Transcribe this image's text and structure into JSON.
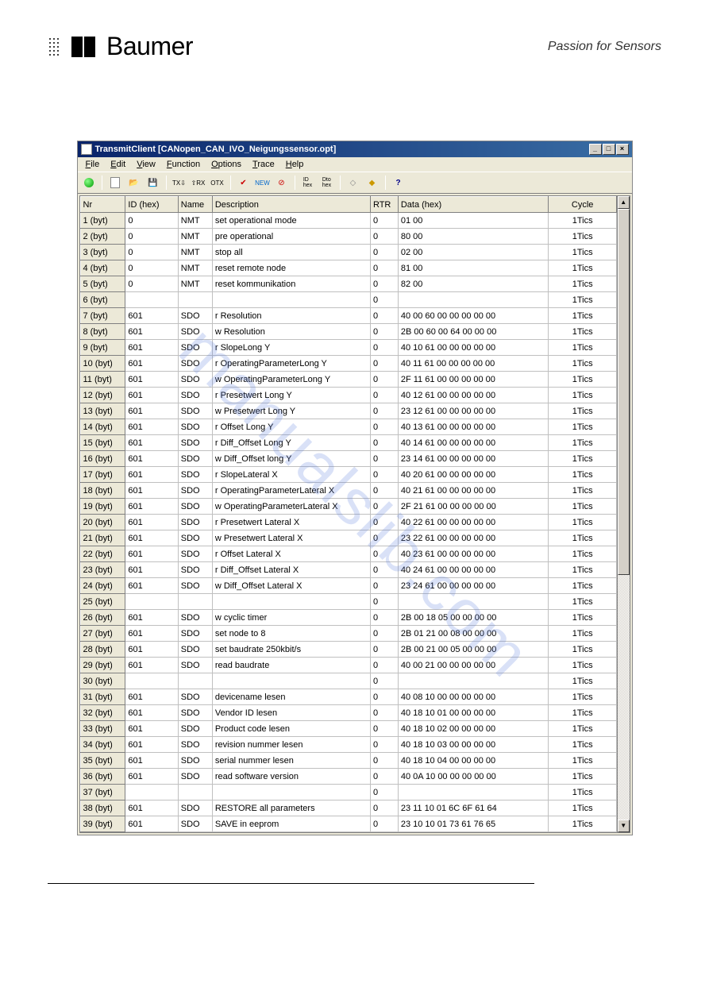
{
  "brand": {
    "name": "Baumer",
    "tagline": "Passion for Sensors"
  },
  "watermark": "manualslib.com",
  "window": {
    "title": "TransmitClient [CANopen_CAN_IVO_Neigungssensor.opt]",
    "menus": [
      "File",
      "Edit",
      "View",
      "Function",
      "Options",
      "Trace",
      "Help"
    ],
    "win_btns": {
      "min": "_",
      "max": "□",
      "close": "×"
    }
  },
  "toolbar": {
    "groups": [
      [
        "green"
      ],
      [
        "new",
        "open",
        "save"
      ],
      [
        "tx",
        "rx",
        "otx"
      ],
      [
        "check",
        "new2",
        "stop"
      ],
      [
        "idhex",
        "dtohex"
      ],
      [
        "up",
        "down"
      ],
      [
        "help"
      ]
    ]
  },
  "grid": {
    "headers": [
      "Nr",
      "ID (hex)",
      "Name",
      "Description",
      "RTR",
      "Data (hex)",
      "Cycle"
    ],
    "rows": [
      {
        "nr": "1 (byt)",
        "id": "0",
        "name": "NMT",
        "desc": "set operational mode",
        "rtr": "0",
        "data": "01 00",
        "cycle": "1Tics"
      },
      {
        "nr": "2 (byt)",
        "id": "0",
        "name": "NMT",
        "desc": "pre operational",
        "rtr": "0",
        "data": "80 00",
        "cycle": "1Tics"
      },
      {
        "nr": "3 (byt)",
        "id": "0",
        "name": "NMT",
        "desc": "stop all",
        "rtr": "0",
        "data": "02 00",
        "cycle": "1Tics"
      },
      {
        "nr": "4 (byt)",
        "id": "0",
        "name": "NMT",
        "desc": "reset remote node",
        "rtr": "0",
        "data": "81 00",
        "cycle": "1Tics"
      },
      {
        "nr": "5 (byt)",
        "id": "0",
        "name": "NMT",
        "desc": "reset kommunikation",
        "rtr": "0",
        "data": "82 00",
        "cycle": "1Tics"
      },
      {
        "nr": "6 (byt)",
        "id": "",
        "name": "",
        "desc": "",
        "rtr": "0",
        "data": "",
        "cycle": "1Tics"
      },
      {
        "nr": "7 (byt)",
        "id": "601",
        "name": "SDO",
        "desc": "r Resolution",
        "rtr": "0",
        "data": "40 00 60 00 00 00 00 00",
        "cycle": "1Tics"
      },
      {
        "nr": "8 (byt)",
        "id": "601",
        "name": "SDO",
        "desc": "w Resolution",
        "rtr": "0",
        "data": "2B 00 60 00 64 00 00 00",
        "cycle": "1Tics"
      },
      {
        "nr": "9 (byt)",
        "id": "601",
        "name": "SDO",
        "desc": "r SlopeLong Y",
        "rtr": "0",
        "data": "40 10 61 00 00 00 00 00",
        "cycle": "1Tics"
      },
      {
        "nr": "10 (byt)",
        "id": "601",
        "name": "SDO",
        "desc": "r OperatingParameterLong Y",
        "rtr": "0",
        "data": "40 11 61 00 00 00 00 00",
        "cycle": "1Tics"
      },
      {
        "nr": "11 (byt)",
        "id": "601",
        "name": "SDO",
        "desc": "w OperatingParameterLong Y",
        "rtr": "0",
        "data": "2F 11 61 00 00 00 00 00",
        "cycle": "1Tics"
      },
      {
        "nr": "12 (byt)",
        "id": "601",
        "name": "SDO",
        "desc": "r Presetwert Long Y",
        "rtr": "0",
        "data": "40 12 61 00 00 00 00 00",
        "cycle": "1Tics"
      },
      {
        "nr": "13 (byt)",
        "id": "601",
        "name": "SDO",
        "desc": "w Presetwert Long  Y",
        "rtr": "0",
        "data": "23 12 61 00 00 00 00 00",
        "cycle": "1Tics"
      },
      {
        "nr": "14 (byt)",
        "id": "601",
        "name": "SDO",
        "desc": "r Offset Long  Y",
        "rtr": "0",
        "data": "40 13 61 00 00 00 00 00",
        "cycle": "1Tics"
      },
      {
        "nr": "15 (byt)",
        "id": "601",
        "name": "SDO",
        "desc": "r Diff_Offset Long Y",
        "rtr": "0",
        "data": "40 14 61 00 00 00 00 00",
        "cycle": "1Tics"
      },
      {
        "nr": "16 (byt)",
        "id": "601",
        "name": "SDO",
        "desc": "w Diff_Offset long Y",
        "rtr": "0",
        "data": "23 14 61 00 00 00 00 00",
        "cycle": "1Tics"
      },
      {
        "nr": "17 (byt)",
        "id": "601",
        "name": "SDO",
        "desc": "r SlopeLateral X",
        "rtr": "0",
        "data": "40 20 61 00 00 00 00 00",
        "cycle": "1Tics"
      },
      {
        "nr": "18 (byt)",
        "id": "601",
        "name": "SDO",
        "desc": "r OperatingParameterLateral  X",
        "rtr": "0",
        "data": "40 21 61 00 00 00 00 00",
        "cycle": "1Tics"
      },
      {
        "nr": "19 (byt)",
        "id": "601",
        "name": "SDO",
        "desc": "w OperatingParameterLateral X",
        "rtr": "0",
        "data": "2F 21 61 00 00 00 00 00",
        "cycle": "1Tics"
      },
      {
        "nr": "20 (byt)",
        "id": "601",
        "name": "SDO",
        "desc": "r Presetwert  Lateral X",
        "rtr": "0",
        "data": "40 22 61 00 00 00 00 00",
        "cycle": "1Tics"
      },
      {
        "nr": "21 (byt)",
        "id": "601",
        "name": "SDO",
        "desc": "w Presetwert  Lateral X",
        "rtr": "0",
        "data": "23 22 61 00 00 00 00 00",
        "cycle": "1Tics"
      },
      {
        "nr": "22 (byt)",
        "id": "601",
        "name": "SDO",
        "desc": "r Offset  Lateral X",
        "rtr": "0",
        "data": "40 23 61 00 00 00 00 00",
        "cycle": "1Tics"
      },
      {
        "nr": "23 (byt)",
        "id": "601",
        "name": "SDO",
        "desc": "r Diff_Offset Lateral  X",
        "rtr": "0",
        "data": "40 24 61 00 00 00 00 00",
        "cycle": "1Tics"
      },
      {
        "nr": "24 (byt)",
        "id": "601",
        "name": "SDO",
        "desc": "w Diff_Offset  Lateral X",
        "rtr": "0",
        "data": "23 24 61 00 00 00 00 00",
        "cycle": "1Tics"
      },
      {
        "nr": "25 (byt)",
        "id": "",
        "name": "",
        "desc": "",
        "rtr": "0",
        "data": "",
        "cycle": "1Tics"
      },
      {
        "nr": "26 (byt)",
        "id": "601",
        "name": "SDO",
        "desc": "w cyclic timer",
        "rtr": "0",
        "data": "2B 00 18 05 00 00 00 00",
        "cycle": "1Tics"
      },
      {
        "nr": "27 (byt)",
        "id": "601",
        "name": "SDO",
        "desc": "set node to  8",
        "rtr": "0",
        "data": "2B 01 21 00 08 00 00 00",
        "cycle": "1Tics"
      },
      {
        "nr": "28 (byt)",
        "id": "601",
        "name": "SDO",
        "desc": "set baudrate 250kbit/s",
        "rtr": "0",
        "data": "2B 00 21 00 05 00 00 00",
        "cycle": "1Tics"
      },
      {
        "nr": "29 (byt)",
        "id": "601",
        "name": "SDO",
        "desc": "read baudrate",
        "rtr": "0",
        "data": "40 00 21 00 00 00 00 00",
        "cycle": "1Tics"
      },
      {
        "nr": "30 (byt)",
        "id": "",
        "name": "",
        "desc": "",
        "rtr": "0",
        "data": "",
        "cycle": "1Tics"
      },
      {
        "nr": "31 (byt)",
        "id": "601",
        "name": "SDO",
        "desc": "devicename lesen",
        "rtr": "0",
        "data": "40 08 10 00 00 00 00 00",
        "cycle": "1Tics"
      },
      {
        "nr": "32 (byt)",
        "id": "601",
        "name": "SDO",
        "desc": "Vendor ID lesen",
        "rtr": "0",
        "data": "40 18 10 01 00 00 00 00",
        "cycle": "1Tics"
      },
      {
        "nr": "33 (byt)",
        "id": "601",
        "name": "SDO",
        "desc": "Product code lesen",
        "rtr": "0",
        "data": "40 18 10 02 00 00 00 00",
        "cycle": "1Tics"
      },
      {
        "nr": "34 (byt)",
        "id": "601",
        "name": "SDO",
        "desc": "revision nummer lesen",
        "rtr": "0",
        "data": "40 18 10 03 00 00 00 00",
        "cycle": "1Tics"
      },
      {
        "nr": "35 (byt)",
        "id": "601",
        "name": "SDO",
        "desc": "serial nummer lesen",
        "rtr": "0",
        "data": "40 18 10 04 00 00 00 00",
        "cycle": "1Tics"
      },
      {
        "nr": "36 (byt)",
        "id": "601",
        "name": "SDO",
        "desc": "read software version",
        "rtr": "0",
        "data": "40 0A 10 00 00 00 00 00",
        "cycle": "1Tics"
      },
      {
        "nr": "37 (byt)",
        "id": "",
        "name": "",
        "desc": "",
        "rtr": "0",
        "data": "",
        "cycle": "1Tics"
      },
      {
        "nr": "38 (byt)",
        "id": "601",
        "name": "SDO",
        "desc": "RESTORE all parameters",
        "rtr": "0",
        "data": "23 11 10 01 6C 6F 61 64",
        "cycle": "1Tics"
      },
      {
        "nr": "39 (byt)",
        "id": "601",
        "name": "SDO",
        "desc": "SAVE  in eeprom",
        "rtr": "0",
        "data": "23 10 10 01 73 61 76 65",
        "cycle": "1Tics"
      }
    ]
  }
}
